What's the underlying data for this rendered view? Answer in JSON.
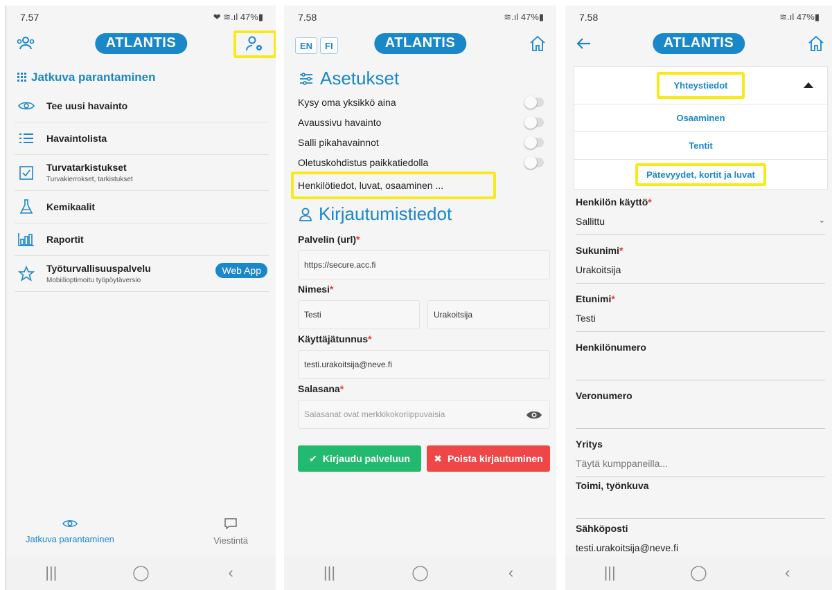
{
  "colors": {
    "accent": "#1a87c9",
    "highlight": "#f8ea1a",
    "success": "#21ba6f",
    "danger": "#ef4747"
  },
  "app": {
    "logo": "ATLANTIS"
  },
  "screen1": {
    "status": {
      "time": "7.57",
      "icons": "❤ ≋.ıl 47%▮"
    },
    "section_title": "Jatkuva parantaminen",
    "menu": [
      {
        "icon": "eye-icon",
        "label": "Tee uusi havainto",
        "sub": ""
      },
      {
        "icon": "list-icon",
        "label": "Havaintolista",
        "sub": ""
      },
      {
        "icon": "checkbox-icon",
        "label": "Turvatarkistukset",
        "sub": "Turvakierrokset, tarkistukset"
      },
      {
        "icon": "flask-icon",
        "label": "Kemikaalit",
        "sub": ""
      },
      {
        "icon": "bar-chart-icon",
        "label": "Raportit",
        "sub": ""
      },
      {
        "icon": "star-icon",
        "label": "Työturvallisuuspalvelu",
        "sub": "Mobiilioptimoitu työpöytäversio",
        "badge": "Web App"
      }
    ],
    "tabs": {
      "left": "Jatkuva parantaminen",
      "right": "Viestintä"
    }
  },
  "screen2": {
    "status": {
      "time": "7.58",
      "icons": "≋.ıl 47%▮"
    },
    "lang": {
      "en": "EN",
      "fi": "FI"
    },
    "settings_title": "Asetukset",
    "settings": [
      {
        "label": "Kysy oma yksikkö aina"
      },
      {
        "label": "Avaussivu havainto"
      },
      {
        "label": "Salli pikahavainnot"
      },
      {
        "label": "Oletuskohdistus paikkatiedolla"
      }
    ],
    "highlight_row": "Henkilötiedot, luvat, osaaminen ...",
    "login_title": "Kirjautumistiedot",
    "fields": {
      "server_label": "Palvelin (url)",
      "server_value": "https://secure.acc.fi",
      "name_label": "Nimesi",
      "first_name": "Testi",
      "last_name": "Urakoitsija",
      "username_label": "Käyttäjätunnus",
      "username_value": "testi.urakoitsija@neve.fi",
      "password_label": "Salasana",
      "password_placeholder": "Salasanat ovat merkkikokoriippuvaisia"
    },
    "buttons": {
      "login": "Kirjaudu palveluun",
      "remove": "Poista kirjautuminen"
    }
  },
  "screen3": {
    "status": {
      "time": "7.58",
      "icons": "≋.ıl 47%▮"
    },
    "dropdown": [
      "Yhteystiedot",
      "Osaaminen",
      "Tentit",
      "Pätevyydet, kortit ja luvat"
    ],
    "fields": [
      {
        "label": "Henkilön käyttö",
        "required": true,
        "value": "Sallittu",
        "select": true
      },
      {
        "label": "Sukunimi",
        "required": true,
        "value": "Urakoitsija"
      },
      {
        "label": "Etunimi",
        "required": true,
        "value": "Testi"
      },
      {
        "label": "Henkilönumero",
        "value": ""
      },
      {
        "label": "Veronumero",
        "value": ""
      },
      {
        "label": "Yritys",
        "placeholder": "Täytä kumppaneilla..."
      },
      {
        "label": "Toimi, työnkuva",
        "value": ""
      },
      {
        "label": "Sähköposti",
        "value": "testi.urakoitsija@neve.fi"
      }
    ]
  }
}
